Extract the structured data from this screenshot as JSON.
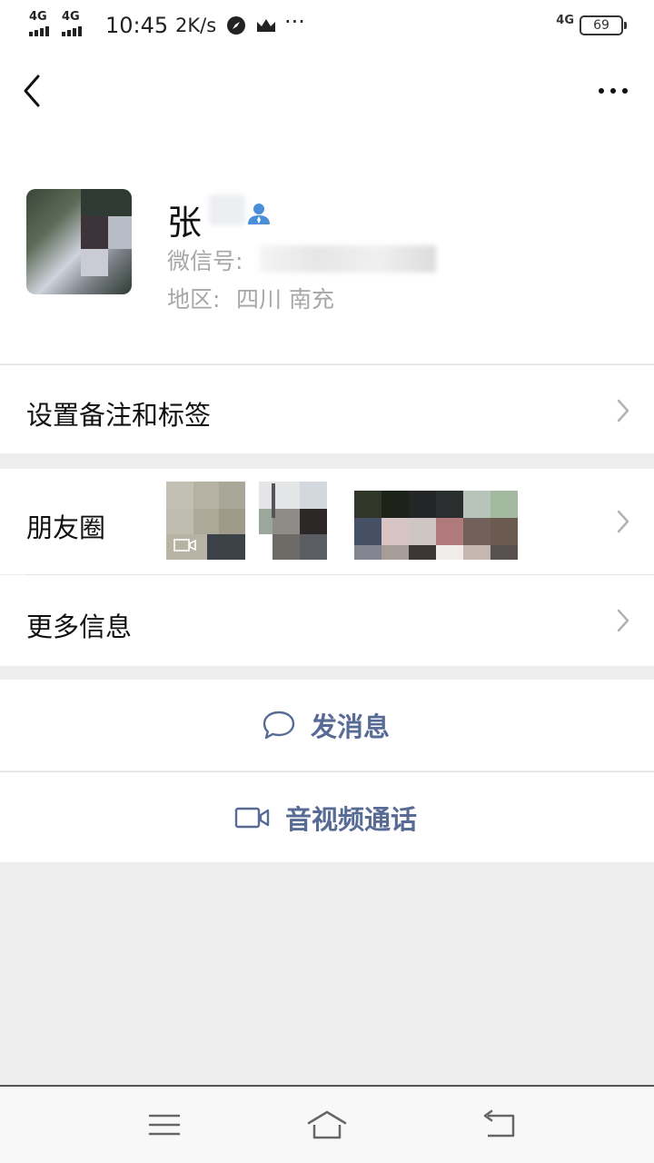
{
  "status_bar": {
    "network1": "4G",
    "network2": "4G",
    "time": "10:45",
    "speed": "2K/s",
    "more": "···",
    "network_right": "4G",
    "battery": "69"
  },
  "profile": {
    "name": "张",
    "wechat_id_label": "微信号:",
    "region_label": "地区:",
    "region_value": "四川  南充"
  },
  "rows": {
    "remark": "设置备注和标签",
    "moments": "朋友圈",
    "more_info": "更多信息"
  },
  "actions": {
    "message": "发消息",
    "video_call": "音视频通话"
  },
  "colors": {
    "link_blue": "#576b95",
    "page_bg": "#ededed",
    "secondary_text": "#a7a7a7"
  }
}
